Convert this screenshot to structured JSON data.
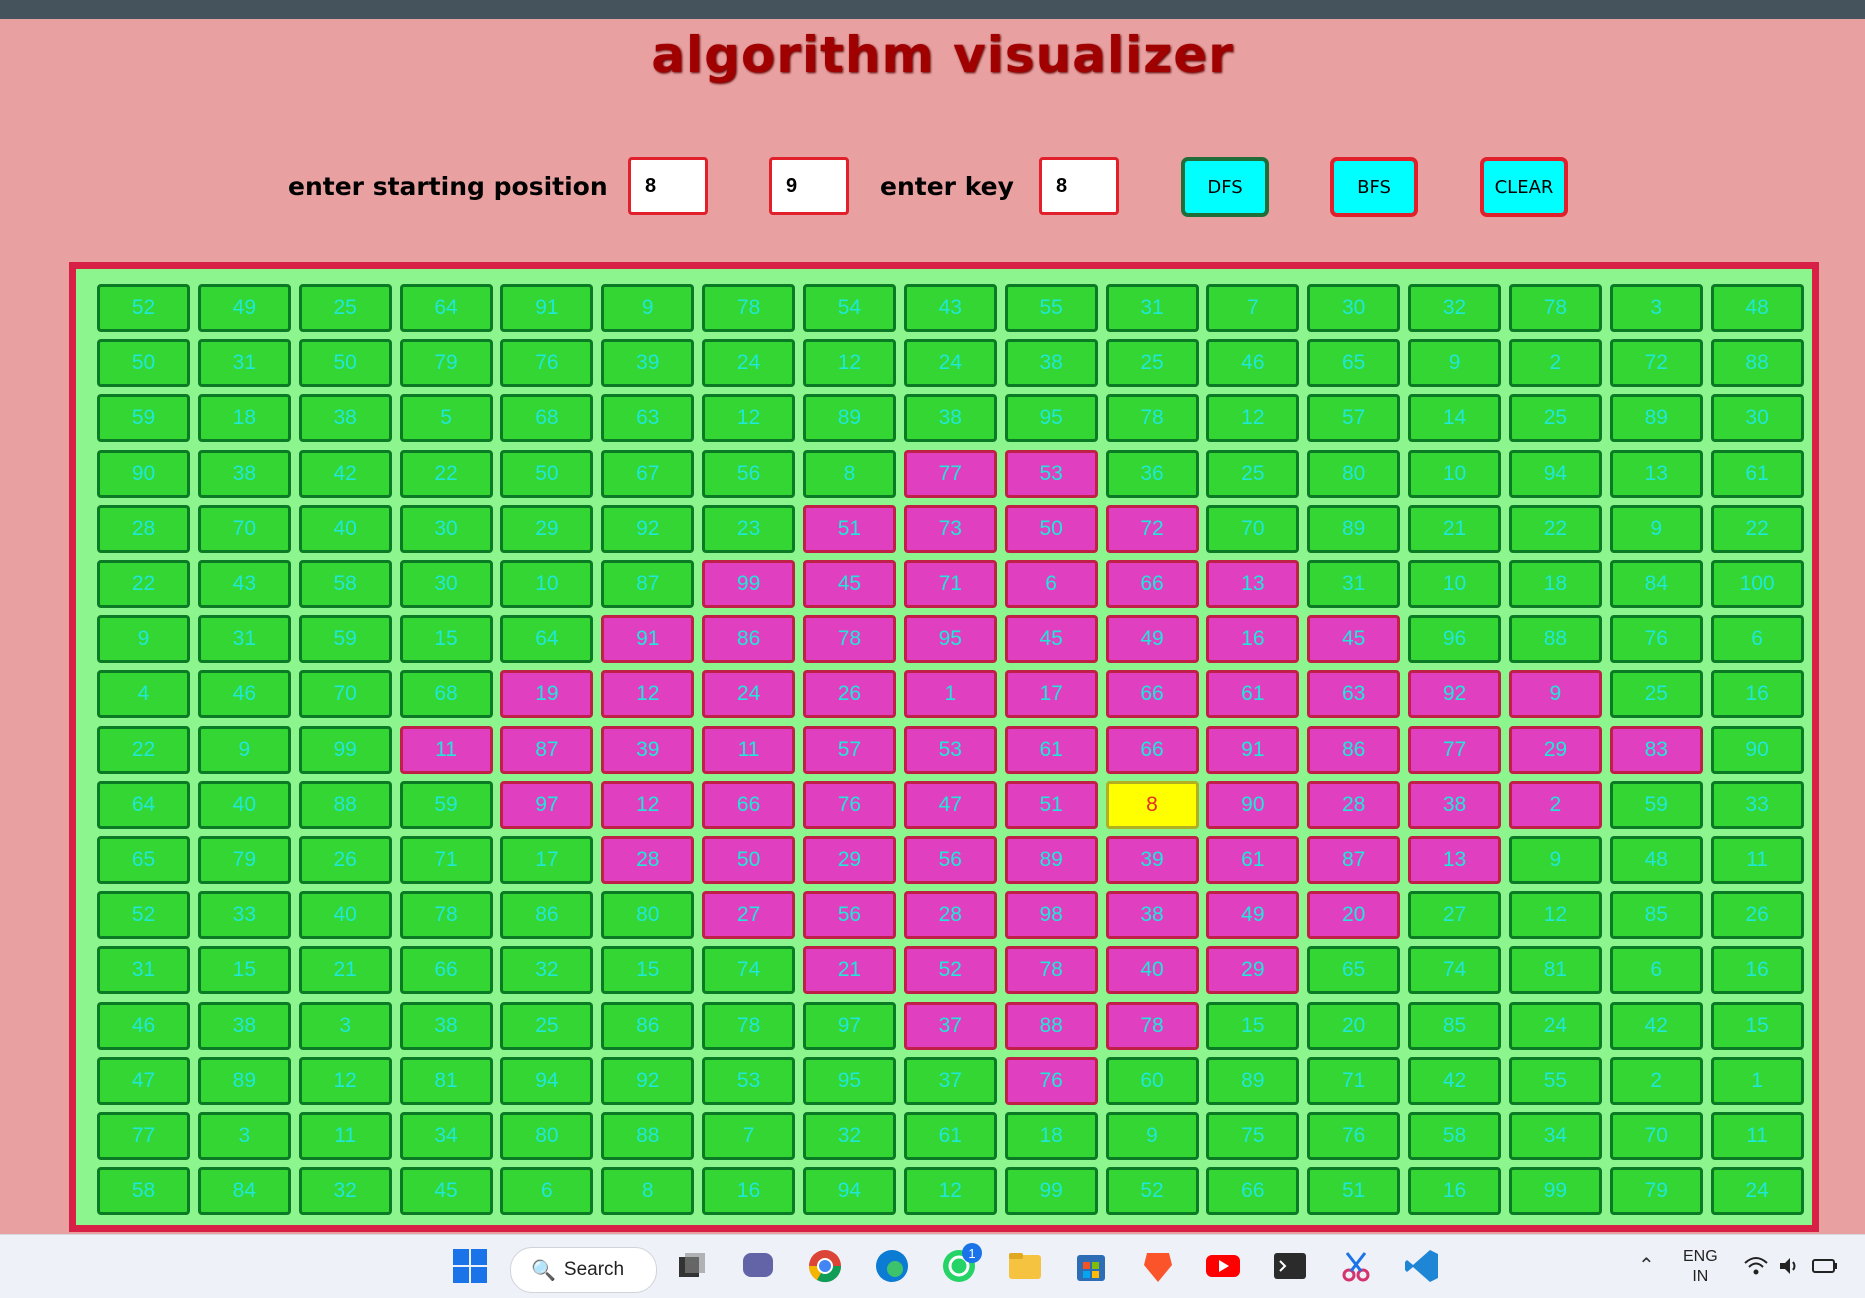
{
  "app": {
    "title": "algorithm visualizer"
  },
  "controls": {
    "start_label": "enter starting position",
    "start_row": "8",
    "start_col": "9",
    "key_label": "enter key",
    "key_value": "8",
    "dfs_label": "DFS",
    "bfs_label": "BFS",
    "clear_label": "CLEAR"
  },
  "colors": {
    "page_bg": "#e8a0a0",
    "title": "#a00000",
    "grid_bg": "#8df58d",
    "grid_border": "#d81f46",
    "cell_unvisited": "#33d633",
    "cell_visited": "#e040c0",
    "cell_found": "#ffff00",
    "button_bg": "#00ffff"
  },
  "grid": {
    "rows": [
      [
        52,
        49,
        25,
        64,
        91,
        9,
        78,
        54,
        43,
        55,
        31,
        7,
        30,
        32,
        78,
        3,
        48
      ],
      [
        50,
        31,
        50,
        79,
        76,
        39,
        24,
        12,
        24,
        38,
        25,
        46,
        65,
        9,
        2,
        72,
        88
      ],
      [
        59,
        18,
        38,
        5,
        68,
        63,
        12,
        89,
        38,
        95,
        78,
        12,
        57,
        14,
        25,
        89,
        30
      ],
      [
        90,
        38,
        42,
        22,
        50,
        67,
        56,
        8,
        77,
        53,
        36,
        25,
        80,
        10,
        94,
        13,
        61
      ],
      [
        28,
        70,
        40,
        30,
        29,
        92,
        23,
        51,
        73,
        50,
        72,
        70,
        89,
        21,
        22,
        9,
        22
      ],
      [
        22,
        43,
        58,
        30,
        10,
        87,
        99,
        45,
        71,
        6,
        66,
        13,
        31,
        10,
        18,
        84,
        100
      ],
      [
        9,
        31,
        59,
        15,
        64,
        91,
        86,
        78,
        95,
        45,
        49,
        16,
        45,
        96,
        88,
        76,
        6
      ],
      [
        4,
        46,
        70,
        68,
        19,
        12,
        24,
        26,
        1,
        17,
        66,
        61,
        63,
        92,
        9,
        25,
        16
      ],
      [
        22,
        9,
        99,
        11,
        87,
        39,
        11,
        57,
        53,
        61,
        66,
        91,
        86,
        77,
        29,
        83,
        90
      ],
      [
        64,
        40,
        88,
        59,
        97,
        12,
        66,
        76,
        47,
        51,
        8,
        90,
        28,
        38,
        2,
        59,
        33
      ],
      [
        65,
        79,
        26,
        71,
        17,
        28,
        50,
        29,
        56,
        89,
        39,
        61,
        87,
        13,
        9,
        48,
        11
      ],
      [
        52,
        33,
        40,
        78,
        86,
        80,
        27,
        56,
        28,
        98,
        38,
        49,
        20,
        27,
        12,
        85,
        26
      ],
      [
        31,
        15,
        21,
        66,
        32,
        15,
        74,
        21,
        52,
        78,
        40,
        29,
        65,
        74,
        81,
        6,
        16
      ],
      [
        46,
        38,
        3,
        38,
        25,
        86,
        78,
        97,
        37,
        88,
        78,
        15,
        20,
        85,
        24,
        42,
        15
      ],
      [
        47,
        89,
        12,
        81,
        94,
        92,
        53,
        95,
        37,
        76,
        60,
        89,
        71,
        42,
        55,
        2,
        1
      ],
      [
        77,
        3,
        11,
        34,
        80,
        88,
        7,
        32,
        61,
        18,
        9,
        75,
        76,
        58,
        34,
        70,
        11
      ],
      [
        58,
        84,
        32,
        45,
        6,
        8,
        16,
        94,
        12,
        99,
        52,
        66,
        51,
        16,
        99,
        79,
        24
      ]
    ],
    "visited": [
      [
        3,
        8
      ],
      [
        3,
        9
      ],
      [
        4,
        7
      ],
      [
        4,
        8
      ],
      [
        4,
        9
      ],
      [
        4,
        10
      ],
      [
        5,
        6
      ],
      [
        5,
        7
      ],
      [
        5,
        8
      ],
      [
        5,
        9
      ],
      [
        5,
        10
      ],
      [
        5,
        11
      ],
      [
        6,
        5
      ],
      [
        6,
        6
      ],
      [
        6,
        7
      ],
      [
        6,
        8
      ],
      [
        6,
        9
      ],
      [
        6,
        10
      ],
      [
        6,
        11
      ],
      [
        6,
        12
      ],
      [
        7,
        4
      ],
      [
        7,
        5
      ],
      [
        7,
        6
      ],
      [
        7,
        7
      ],
      [
        7,
        8
      ],
      [
        7,
        9
      ],
      [
        7,
        10
      ],
      [
        7,
        11
      ],
      [
        7,
        12
      ],
      [
        7,
        13
      ],
      [
        7,
        14
      ],
      [
        8,
        3
      ],
      [
        8,
        4
      ],
      [
        8,
        5
      ],
      [
        8,
        6
      ],
      [
        8,
        7
      ],
      [
        8,
        8
      ],
      [
        8,
        9
      ],
      [
        8,
        10
      ],
      [
        8,
        11
      ],
      [
        8,
        12
      ],
      [
        8,
        13
      ],
      [
        8,
        14
      ],
      [
        8,
        15
      ],
      [
        9,
        4
      ],
      [
        9,
        5
      ],
      [
        9,
        6
      ],
      [
        9,
        7
      ],
      [
        9,
        8
      ],
      [
        9,
        9
      ],
      [
        9,
        11
      ],
      [
        9,
        12
      ],
      [
        9,
        13
      ],
      [
        9,
        14
      ],
      [
        10,
        5
      ],
      [
        10,
        6
      ],
      [
        10,
        7
      ],
      [
        10,
        8
      ],
      [
        10,
        9
      ],
      [
        10,
        10
      ],
      [
        10,
        11
      ],
      [
        10,
        12
      ],
      [
        10,
        13
      ],
      [
        11,
        6
      ],
      [
        11,
        7
      ],
      [
        11,
        8
      ],
      [
        11,
        9
      ],
      [
        11,
        10
      ],
      [
        11,
        11
      ],
      [
        11,
        12
      ],
      [
        12,
        7
      ],
      [
        12,
        8
      ],
      [
        12,
        9
      ],
      [
        12,
        10
      ],
      [
        12,
        11
      ],
      [
        13,
        8
      ],
      [
        13,
        9
      ],
      [
        13,
        10
      ],
      [
        14,
        9
      ]
    ],
    "found": [
      9,
      10
    ]
  },
  "taskbar": {
    "search_label": "Search",
    "lang_line1": "ENG",
    "lang_line2": "IN",
    "whatsapp_badge": "1"
  }
}
